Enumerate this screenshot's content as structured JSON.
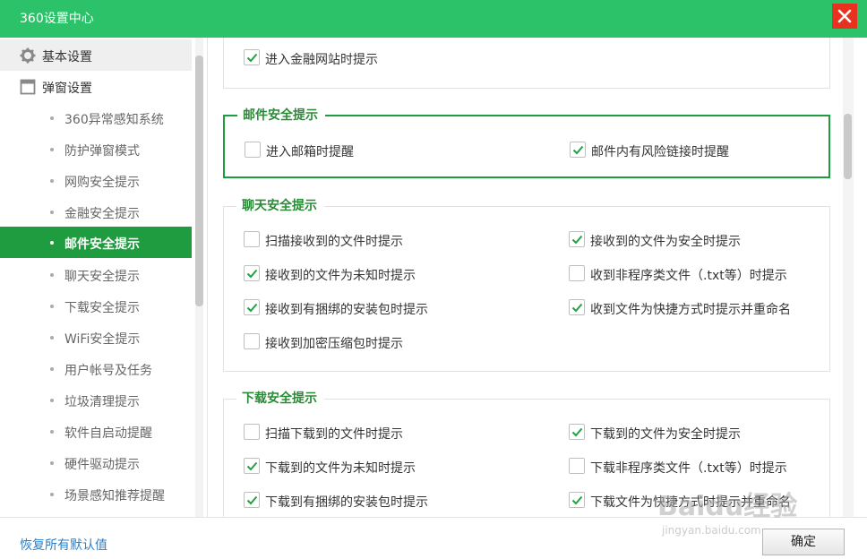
{
  "window": {
    "title": "360设置中心"
  },
  "sidebar": {
    "groups": [
      {
        "label": "基本设置",
        "icon": "gear-icon"
      },
      {
        "label": "弹窗设置",
        "icon": "window-icon"
      }
    ],
    "items": [
      {
        "label": "360异常感知系统"
      },
      {
        "label": "防护弹窗模式"
      },
      {
        "label": "网购安全提示"
      },
      {
        "label": "金融安全提示"
      },
      {
        "label": "邮件安全提示",
        "active": true
      },
      {
        "label": "聊天安全提示"
      },
      {
        "label": "下载安全提示"
      },
      {
        "label": "WiFi安全提示"
      },
      {
        "label": "用户帐号及任务"
      },
      {
        "label": "垃圾清理提示"
      },
      {
        "label": "软件自启动提醒"
      },
      {
        "label": "硬件驱动提示"
      },
      {
        "label": "场景感知推荐提醒"
      }
    ]
  },
  "sections": {
    "finance": {
      "options": [
        {
          "label": "进入金融网站时提示",
          "checked": true
        }
      ]
    },
    "mail": {
      "title": "邮件安全提示",
      "options": [
        {
          "label": "进入邮箱时提醒",
          "checked": false
        },
        {
          "label": "邮件内有风险链接时提醒",
          "checked": true
        }
      ]
    },
    "chat": {
      "title": "聊天安全提示",
      "options": [
        {
          "label": "扫描接收到的文件时提示",
          "checked": false
        },
        {
          "label": "接收到的文件为安全时提示",
          "checked": true
        },
        {
          "label": "接收到的文件为未知时提示",
          "checked": true
        },
        {
          "label": "收到非程序类文件（.txt等）时提示",
          "checked": false
        },
        {
          "label": "接收到有捆绑的安装包时提示",
          "checked": true
        },
        {
          "label": "收到文件为快捷方式时提示并重命名",
          "checked": true
        },
        {
          "label": "接收到加密压缩包时提示",
          "checked": false
        }
      ]
    },
    "download": {
      "title": "下载安全提示",
      "options": [
        {
          "label": "扫描下载到的文件时提示",
          "checked": false
        },
        {
          "label": "下载到的文件为安全时提示",
          "checked": true
        },
        {
          "label": "下载到的文件为未知时提示",
          "checked": true
        },
        {
          "label": "下载非程序类文件（.txt等）时提示",
          "checked": false
        },
        {
          "label": "下载到有捆绑的安装包时提示",
          "checked": true
        },
        {
          "label": "下载文件为快捷方式时提示并重命名",
          "checked": true
        }
      ]
    }
  },
  "footer": {
    "reset_label": "恢复所有默认值",
    "ok_label": "确定"
  },
  "watermark": {
    "text": "Baidu经验",
    "url": "jingyan.baidu.com"
  },
  "colors": {
    "titlebar": "#2cc26a",
    "accent": "#1f9c3f",
    "close": "#e8321f",
    "link": "#2a7fc9"
  }
}
